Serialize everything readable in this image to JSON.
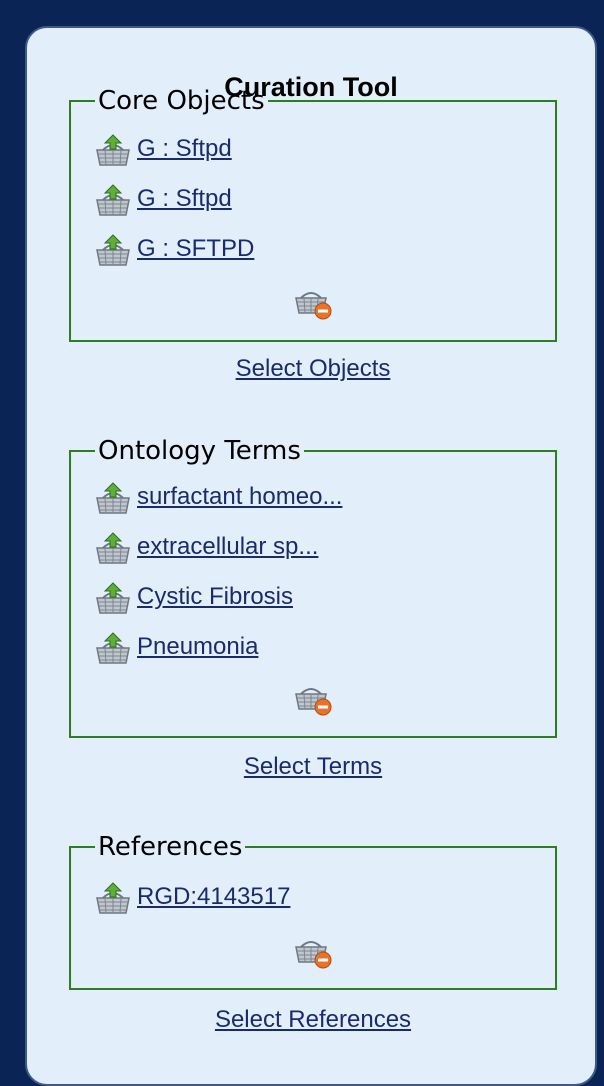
{
  "panel": {
    "title": "Curation Tool"
  },
  "core_objects": {
    "legend": "Core Objects",
    "items": [
      {
        "label": "G : Sftpd"
      },
      {
        "label": "G : Sftpd"
      },
      {
        "label": "G : SFTPD"
      }
    ],
    "select_label": "Select Objects"
  },
  "ontology_terms": {
    "legend": "Ontology Terms",
    "items": [
      {
        "label": "surfactant homeo..."
      },
      {
        "label": "extracellular sp..."
      },
      {
        "label": "Cystic Fibrosis"
      },
      {
        "label": "Pneumonia"
      }
    ],
    "select_label": "Select Terms"
  },
  "references": {
    "legend": "References",
    "items": [
      {
        "label": "RGD:4143517"
      }
    ],
    "select_label": "Select References"
  },
  "icons": {
    "item_icon": "basket-add-icon",
    "remove_icon": "basket-remove-icon"
  },
  "colors": {
    "background": "#0b2456",
    "panel": "#e3eefb",
    "box_border": "#2e7d22",
    "link": "#1a2b6d"
  }
}
